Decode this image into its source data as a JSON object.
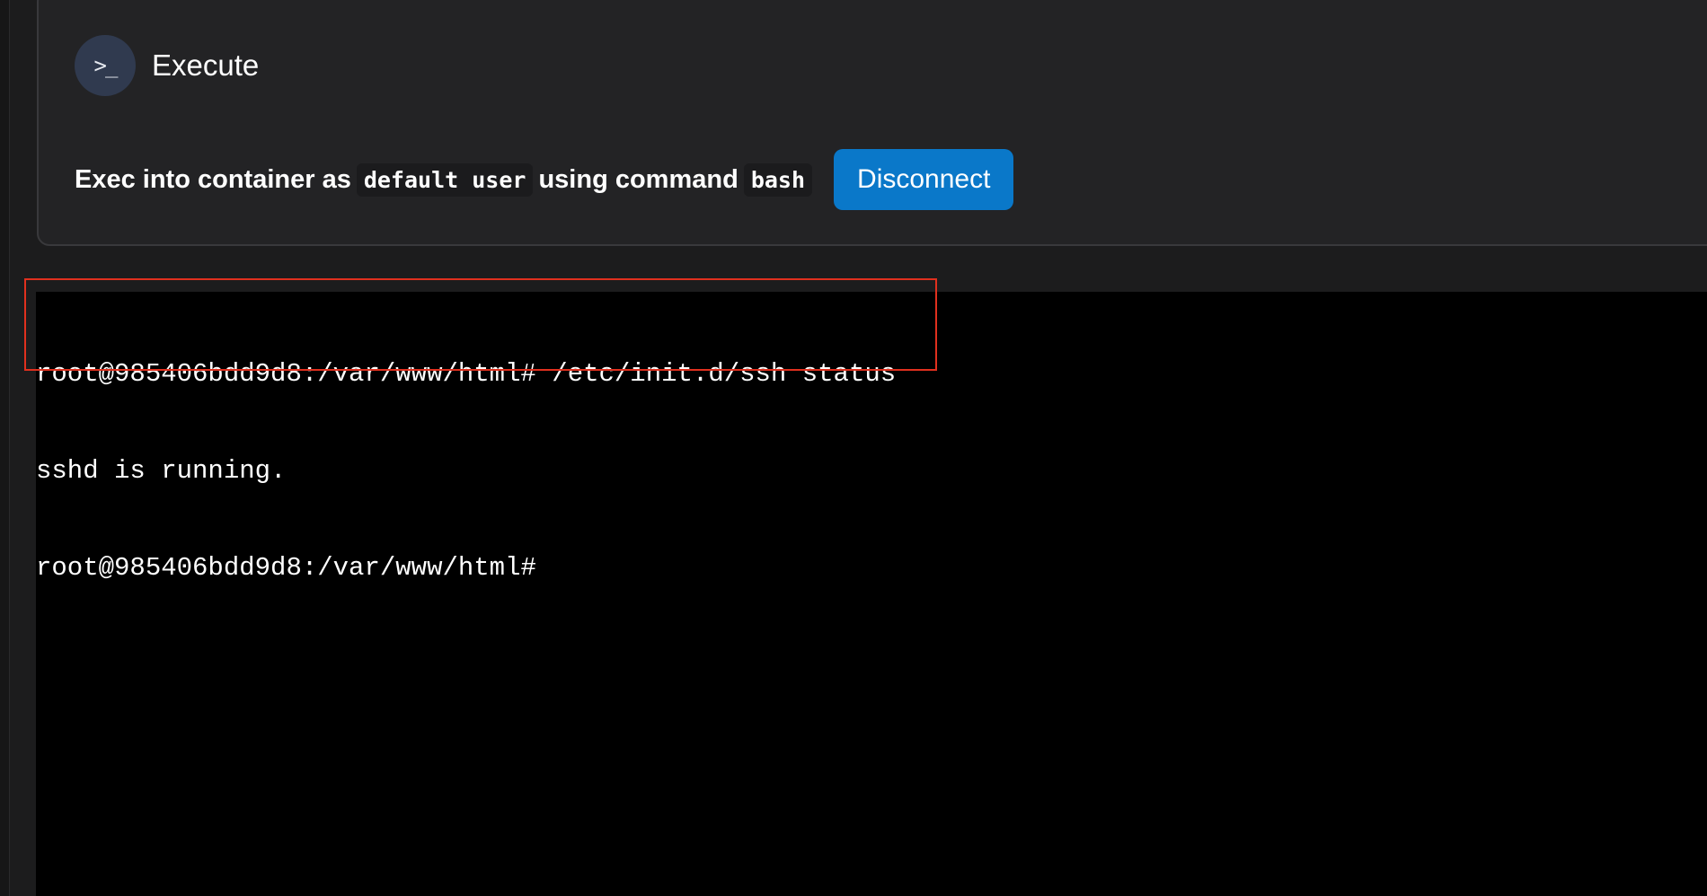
{
  "panel": {
    "title": "Execute",
    "icon": "terminal-prompt-icon",
    "icon_glyph": ">_",
    "exec": {
      "prefix": "Exec into container as",
      "user": "default user",
      "middle": "using command",
      "command": "bash",
      "disconnect_label": "Disconnect"
    }
  },
  "terminal": {
    "lines": [
      "root@985406bdd9d8:/var/www/html# /etc/init.d/ssh status",
      "sshd is running.",
      "root@985406bdd9d8:/var/www/html#"
    ]
  },
  "colors": {
    "accent": "#0a78c9",
    "highlight": "#e0301e",
    "terminal_bg": "#000000"
  }
}
